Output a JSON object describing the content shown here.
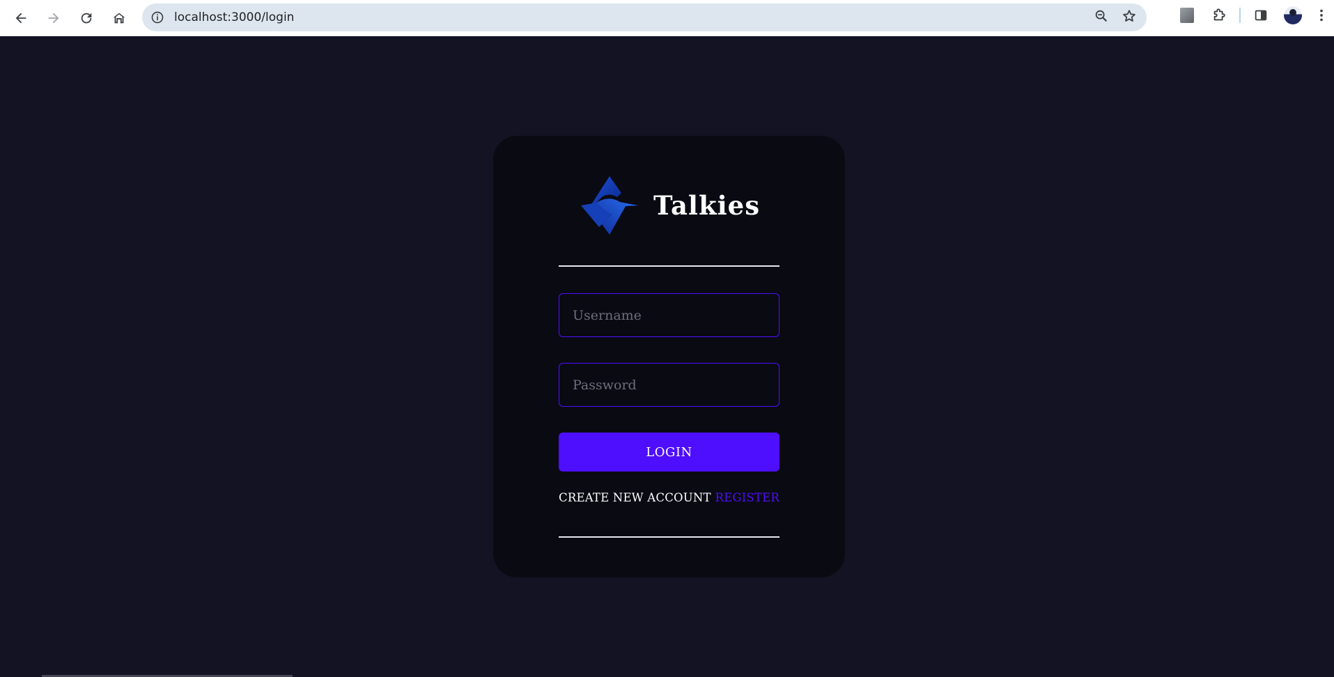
{
  "browser": {
    "url": "localhost:3000/login",
    "icons": {
      "back": "arrow-left-icon",
      "forward": "arrow-right-icon",
      "reload": "reload-icon",
      "home": "home-icon",
      "site_info": "info-icon",
      "zoom": "zoom-icon",
      "bookmark": "star-icon",
      "extensions": "puzzle-icon",
      "side_panel": "side-panel-icon",
      "menu": "kebab-menu-icon"
    }
  },
  "login": {
    "brand_name": "Talkies",
    "username_placeholder": "Username",
    "password_placeholder": "Password",
    "login_label": "LOGIN",
    "create_account_text": "CREATE NEW ACCOUNT",
    "register_label": "REGISTER"
  },
  "colors": {
    "page_background": "#131324",
    "card_background": "#0a0a13",
    "accent": "#4e0eff",
    "text": "#ffffff"
  }
}
